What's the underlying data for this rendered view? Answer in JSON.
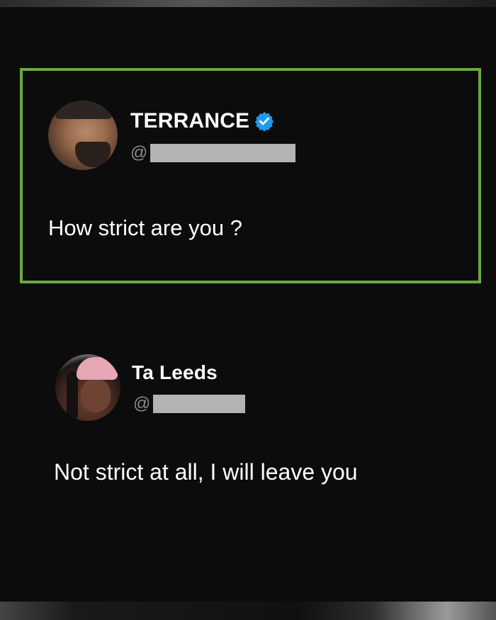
{
  "posts": [
    {
      "display_name": "TERRANCE",
      "verified": true,
      "handle_prefix": "@",
      "body": "How strict are you ?",
      "highlight_color": "#6aa843"
    },
    {
      "display_name": "Ta Leeds",
      "verified": false,
      "handle_prefix": "@",
      "body": "Not strict at all, I will leave you"
    }
  ],
  "icons": {
    "verified": "verified-badge-icon"
  },
  "colors": {
    "background": "#0c0c0c",
    "verified_blue": "#1d9bf0",
    "redaction": "#b3b3b3"
  }
}
